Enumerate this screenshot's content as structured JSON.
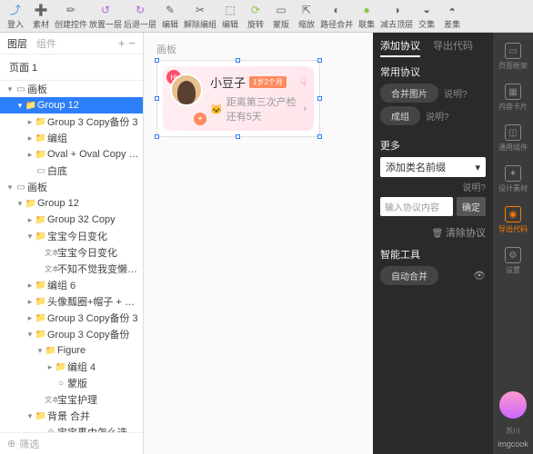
{
  "toolbar": [
    {
      "icon": "⤴",
      "label": "登入",
      "color": "#4a90e2"
    },
    {
      "icon": "➕",
      "label": "素材",
      "color": "#666"
    },
    {
      "icon": "✏",
      "label": "创建控件",
      "color": "#666"
    },
    {
      "icon": "↺",
      "label": "放置一层",
      "color": "#b565d8"
    },
    {
      "icon": "↻",
      "label": "后退一层",
      "color": "#b565d8"
    },
    {
      "icon": "✎",
      "label": "编辑",
      "color": "#666"
    },
    {
      "icon": "✂",
      "label": "解除编组",
      "color": "#666"
    },
    {
      "icon": "⬚",
      "label": "编辑",
      "color": "#666"
    },
    {
      "icon": "⟳",
      "label": "旋转",
      "color": "#8bc34a"
    },
    {
      "icon": "▭",
      "label": "蒙版",
      "color": "#666"
    },
    {
      "icon": "⇱",
      "label": "缩放",
      "color": "#666"
    },
    {
      "icon": "◐",
      "label": "路径合并",
      "color": "#666"
    },
    {
      "icon": "●",
      "label": "联集",
      "color": "#8bc34a"
    },
    {
      "icon": "◑",
      "label": "减去顶层",
      "color": "#666"
    },
    {
      "icon": "◒",
      "label": "交集",
      "color": "#666"
    },
    {
      "icon": "◓",
      "label": "差集",
      "color": "#666"
    }
  ],
  "left": {
    "tab1": "图层",
    "tab2": "组件",
    "page": "页面 1",
    "filter": "筛选",
    "tree": [
      {
        "d": 0,
        "a": "▾",
        "i": "▭",
        "t": "画板",
        "sel": 0
      },
      {
        "d": 1,
        "a": "▾",
        "i": "📁",
        "t": "Group 12",
        "sel": 1
      },
      {
        "d": 2,
        "a": "▸",
        "i": "📁",
        "t": "Group 3 Copy备份 3",
        "sel": 0
      },
      {
        "d": 2,
        "a": "▸",
        "i": "📁",
        "t": "编组",
        "sel": 0
      },
      {
        "d": 2,
        "a": "▸",
        "i": "📁",
        "t": "Oval + Oval Copy + Oval Cop...",
        "sel": 0
      },
      {
        "d": 2,
        "a": "",
        "i": "▭",
        "t": "白底",
        "sel": 0
      },
      {
        "d": 0,
        "a": "▾",
        "i": "▭",
        "t": "画板",
        "sel": 0
      },
      {
        "d": 1,
        "a": "▾",
        "i": "📁",
        "t": "Group 12",
        "sel": 0
      },
      {
        "d": 2,
        "a": "▸",
        "i": "📁",
        "t": "Group 32 Copy",
        "sel": 0
      },
      {
        "d": 2,
        "a": "▾",
        "i": "📁",
        "t": "宝宝今日变化",
        "sel": 0
      },
      {
        "d": 3,
        "a": "",
        "i": "文本",
        "t": "宝宝今日变化",
        "sel": 0
      },
      {
        "d": 3,
        "a": "",
        "i": "文本",
        "t": "不知不觉我变懒了，在拥挤的小房...",
        "sel": 0
      },
      {
        "d": 2,
        "a": "▸",
        "i": "📁",
        "t": "编组 6",
        "sel": 0
      },
      {
        "d": 2,
        "a": "▸",
        "i": "📁",
        "t": "头像瓢圈+帽子 + 雪花",
        "sel": 0
      },
      {
        "d": 2,
        "a": "▸",
        "i": "📁",
        "t": "Group 3 Copy备份 3",
        "sel": 0
      },
      {
        "d": 2,
        "a": "▾",
        "i": "📁",
        "t": "Group 3 Copy备份",
        "sel": 0
      },
      {
        "d": 3,
        "a": "▾",
        "i": "📁",
        "t": "Figure",
        "sel": 0
      },
      {
        "d": 4,
        "a": "▸",
        "i": "📁",
        "t": "编组 4",
        "sel": 0
      },
      {
        "d": 4,
        "a": "",
        "i": "○",
        "t": "蒙版",
        "sel": 0
      },
      {
        "d": 3,
        "a": "",
        "i": "文本",
        "t": "宝宝护理",
        "sel": 0
      },
      {
        "d": 2,
        "a": "▾",
        "i": "📁",
        "t": "背景 合并",
        "sel": 0
      },
      {
        "d": 3,
        "a": "",
        "i": "⟐",
        "t": "宝宝裹巾怎么选",
        "sel": 0
      }
    ]
  },
  "canvas": {
    "label": "画板",
    "name": "小豆子",
    "badge": "1岁2个月",
    "sub": "距离第三次产检还有5天",
    "hi": "Hi"
  },
  "right": {
    "tab1": "添加协议",
    "tab2": "导出代码",
    "sec1": "常用协议",
    "merge": "合并图片",
    "group": "成组",
    "help": "说明?",
    "more": "更多",
    "select": "添加类名前缀",
    "placeholder": "输入协议内容",
    "ok": "确定",
    "clear": "清除协议",
    "smart": "智能工具",
    "auto": "自动合并"
  },
  "far": [
    {
      "i": "▭",
      "t": "页面框架"
    },
    {
      "i": "▦",
      "t": "内容卡片"
    },
    {
      "i": "◫",
      "t": "通用组件"
    },
    {
      "i": "✦",
      "t": "设计素材"
    },
    {
      "i": "◉",
      "t": "导出代码",
      "on": 1
    },
    {
      "i": "⚙",
      "t": "设置"
    }
  ],
  "user": "苏川",
  "brand": "imgcook"
}
